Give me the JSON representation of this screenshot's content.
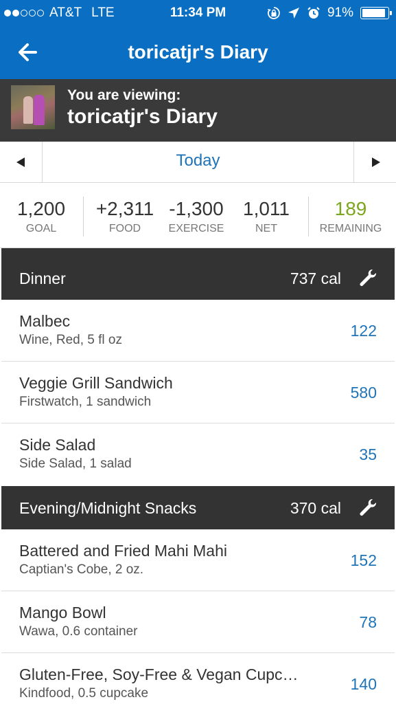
{
  "status_bar": {
    "carrier": "AT&T",
    "network": "LTE",
    "time": "11:34 PM",
    "battery": "91%",
    "battery_level": 0.91,
    "signal_bars_filled": 2,
    "icons": [
      "lock-rotation-icon",
      "location-arrow-icon",
      "alarm-icon",
      "battery-icon"
    ]
  },
  "nav": {
    "title": "toricatjr's Diary",
    "back_icon": "back-arrow-icon"
  },
  "viewing": {
    "label": "You are viewing:",
    "name": "toricatjr's Diary"
  },
  "date_nav": {
    "date": "Today",
    "prev_icon": "triangle-left-icon",
    "next_icon": "triangle-right-icon"
  },
  "summary": {
    "goal": {
      "value": "1,200",
      "label": "GOAL"
    },
    "food": {
      "value": "+2,311",
      "label": "FOOD"
    },
    "exercise": {
      "value": "-1,300",
      "label": "EXERCISE"
    },
    "net": {
      "value": "1,011",
      "label": "NET"
    },
    "remaining": {
      "value": "189",
      "label": "REMAINING"
    }
  },
  "colors": {
    "brand_blue": "#0a6fc2",
    "link_blue": "#1f74b8",
    "remaining_green": "#7da61f",
    "section_bg": "#333333"
  },
  "meals": [
    {
      "name": "Dinner",
      "calories": "737 cal",
      "items": [
        {
          "name": "Malbec",
          "desc": "Wine, Red, 5 fl oz",
          "cal": "122"
        },
        {
          "name": "Veggie Grill Sandwich",
          "desc": "Firstwatch, 1 sandwich",
          "cal": "580"
        },
        {
          "name": "Side Salad",
          "desc": "Side Salad, 1 salad",
          "cal": "35"
        }
      ]
    },
    {
      "name": "Evening/Midnight Snacks",
      "calories": "370 cal",
      "items": [
        {
          "name": "Battered and Fried Mahi Mahi",
          "desc": "Captian's Cobe, 2 oz.",
          "cal": "152"
        },
        {
          "name": "Mango Bowl",
          "desc": "Wawa, 0.6 container",
          "cal": "78"
        },
        {
          "name": "Gluten-Free, Soy-Free & Vegan Cupc…",
          "desc": "Kindfood, 0.5 cupcake",
          "cal": "140"
        }
      ]
    }
  ]
}
